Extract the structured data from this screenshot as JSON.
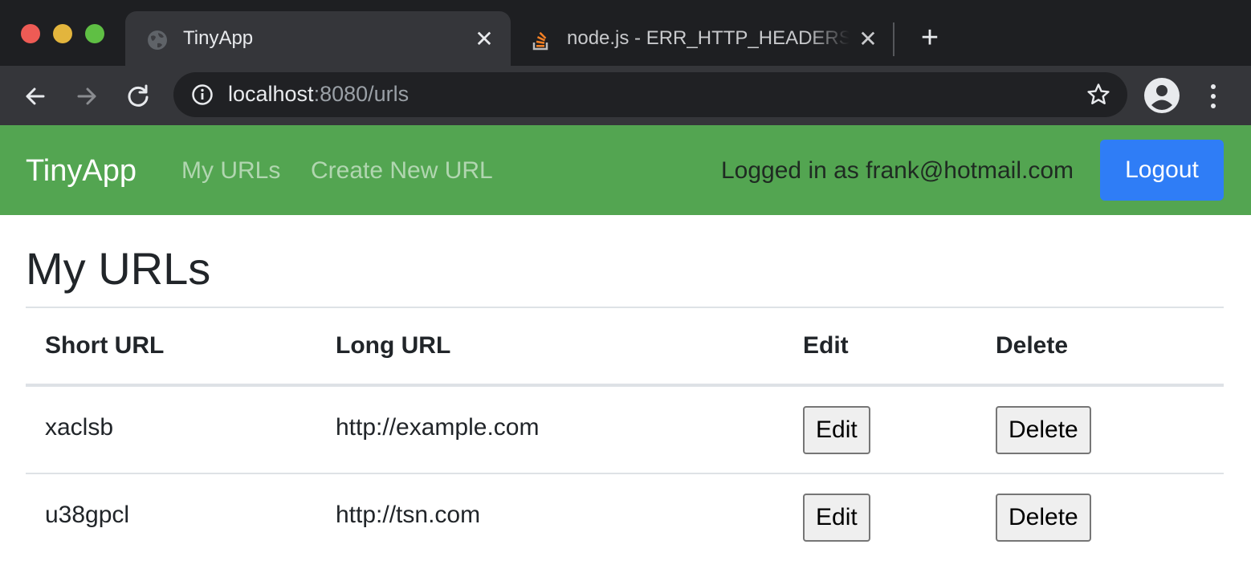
{
  "browser": {
    "tabs": [
      {
        "title": "TinyApp",
        "icon": "globe-icon",
        "active": true
      },
      {
        "title": "node.js - ERR_HTTP_HEADERS_SENT",
        "icon": "stackoverflow-icon",
        "active": false
      }
    ],
    "url": {
      "host": "localhost",
      "rest": ":8080/urls"
    }
  },
  "navbar": {
    "brand": "TinyApp",
    "links": [
      "My URLs",
      "Create New URL"
    ],
    "logged_in_text": "Logged in as frank@hotmail.com",
    "logout_label": "Logout",
    "color": "#53a551",
    "logout_color": "#2f7df6"
  },
  "main": {
    "title": "My URLs",
    "table": {
      "headers": [
        "Short URL",
        "Long URL",
        "Edit",
        "Delete"
      ],
      "rows": [
        {
          "short": "xaclsb",
          "long": "http://example.com",
          "edit_label": "Edit",
          "delete_label": "Delete"
        },
        {
          "short": "u38gpcl",
          "long": "http://tsn.com",
          "edit_label": "Edit",
          "delete_label": "Delete"
        }
      ]
    }
  }
}
